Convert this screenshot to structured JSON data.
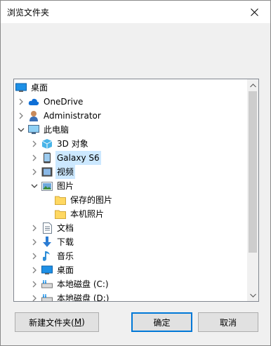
{
  "window": {
    "title": "浏览文件夹"
  },
  "tree": {
    "items": [
      {
        "label": "桌面",
        "icon": "desktop-icon",
        "level": 0,
        "expander": "none"
      },
      {
        "label": "OneDrive",
        "icon": "cloud-icon",
        "level": 1,
        "expander": "collapsed"
      },
      {
        "label": "Administrator",
        "icon": "user-icon",
        "level": 1,
        "expander": "collapsed"
      },
      {
        "label": "此电脑",
        "icon": "computer-icon",
        "level": 1,
        "expander": "expanded"
      },
      {
        "label": "3D 对象",
        "icon": "3d-objects-icon",
        "level": 2,
        "expander": "collapsed"
      },
      {
        "label": "Galaxy S6",
        "icon": "phone-icon",
        "level": 2,
        "expander": "collapsed",
        "selected": true
      },
      {
        "label": "视频",
        "icon": "video-icon",
        "level": 2,
        "expander": "collapsed",
        "selected": true
      },
      {
        "label": "图片",
        "icon": "pictures-icon",
        "level": 2,
        "expander": "expanded"
      },
      {
        "label": "保存的图片",
        "icon": "folder-icon",
        "level": 3,
        "expander": "none"
      },
      {
        "label": "本机照片",
        "icon": "folder-icon",
        "level": 3,
        "expander": "none"
      },
      {
        "label": "文档",
        "icon": "document-icon",
        "level": 2,
        "expander": "collapsed"
      },
      {
        "label": "下载",
        "icon": "download-icon",
        "level": 2,
        "expander": "collapsed"
      },
      {
        "label": "音乐",
        "icon": "music-icon",
        "level": 2,
        "expander": "collapsed"
      },
      {
        "label": "桌面",
        "icon": "desktop-icon",
        "level": 2,
        "expander": "collapsed"
      },
      {
        "label": "本地磁盘 (C:)",
        "icon": "drive-icon",
        "level": 2,
        "expander": "collapsed"
      },
      {
        "label": "本地磁盘 (D:)",
        "icon": "drive-icon",
        "level": 2,
        "expander": "collapsed"
      }
    ]
  },
  "buttons": {
    "new_folder_text": "新建文件夹(",
    "new_folder_accel": "M",
    "new_folder_close": ")",
    "ok": "确定",
    "cancel": "取消"
  },
  "colors": {
    "selection": "#cce8ff",
    "default_button_border": "#0078d7",
    "folder_yellow": "#ffd862"
  }
}
